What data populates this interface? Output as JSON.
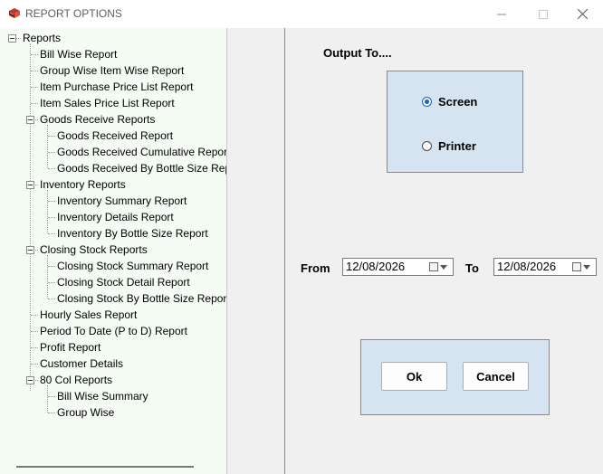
{
  "window": {
    "title": "REPORT OPTIONS",
    "minimize_icon": "minimize-icon",
    "maximize_icon": "maximize-icon",
    "close_icon": "close-icon"
  },
  "tree": {
    "root": "Reports",
    "items": {
      "bill_wise": "Bill Wise Report",
      "group_wise_item": "Group Wise Item Wise Report",
      "item_purchase": "Item Purchase Price List Report",
      "item_sales": "Item Sales Price List Report",
      "goods_receive": "Goods Receive Reports",
      "goods_received": "Goods Received Report",
      "goods_received_cum": "Goods Received Cumulative Report",
      "goods_received_bottle": "Goods Received By Bottle Size Report",
      "inventory": "Inventory Reports",
      "inventory_summary": "Inventory Summary Report",
      "inventory_details": "Inventory Details Report",
      "inventory_bottle": "Inventory By Bottle Size Report",
      "closing_stock": "Closing Stock Reports",
      "closing_summary": "Closing Stock Summary Report",
      "closing_detail": "Closing Stock Detail Report",
      "closing_bottle": "Closing Stock By Bottle Size Report",
      "hourly_sales": "Hourly Sales Report",
      "period_to_date": "Period To Date (P to D) Report",
      "profit": "Profit Report",
      "customer_details": "Customer Details",
      "col80": "80 Col Reports",
      "bill_wise_summary": "Bill Wise Summary",
      "group_wise": "Group Wise"
    }
  },
  "output": {
    "label": "Output To....",
    "options": {
      "screen": "Screen",
      "printer": "Printer"
    },
    "selected": "Screen"
  },
  "dates": {
    "from_label": "From",
    "from_value": "12/08/2026",
    "to_label": "To",
    "to_value": "12/08/2026"
  },
  "buttons": {
    "ok": "Ok",
    "cancel": "Cancel"
  }
}
